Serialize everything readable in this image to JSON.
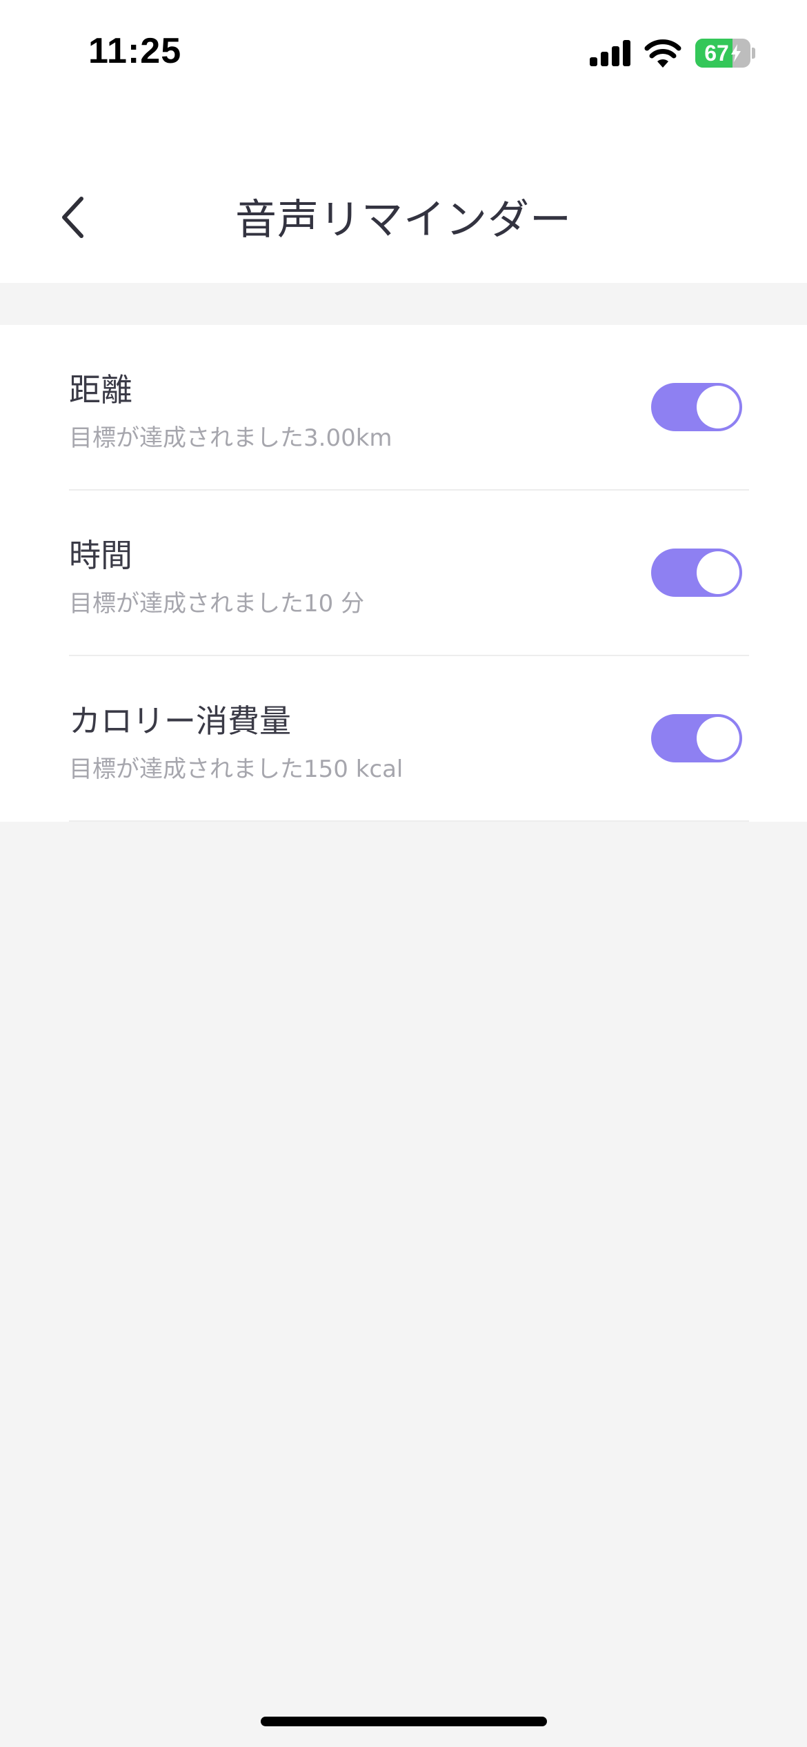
{
  "status_bar": {
    "time": "11:25",
    "battery_percent": 67,
    "battery_label": "67",
    "icons": [
      "signal-icon",
      "wifi-icon",
      "battery-charging-icon"
    ]
  },
  "header": {
    "title": "音声リマインダー",
    "back_icon": "chevron-left-icon"
  },
  "reminders": [
    {
      "title": "距離",
      "subtitle": "目標が達成されました3.00km",
      "enabled": true
    },
    {
      "title": "時間",
      "subtitle": "目標が達成されました10 分",
      "enabled": true
    },
    {
      "title": "カロリー消費量",
      "subtitle": "目標が達成されました150 kcal",
      "enabled": true
    }
  ],
  "colors": {
    "toggle_on": "#8e80f2",
    "battery_green": "#34c759",
    "background": "#f4f4f4"
  }
}
